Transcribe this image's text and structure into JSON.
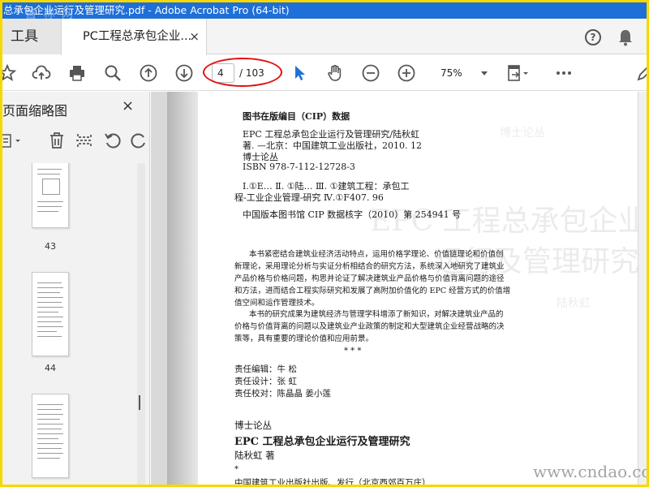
{
  "window": {
    "title": "总承包企业运行及管理研究.pdf - Adobe Acrobat Pro (64-bit)",
    "watermark": "首 称 网"
  },
  "tabs": {
    "tools": "工具",
    "doc": "PC工程总承包企业...",
    "close": "×"
  },
  "toolbar": {
    "page_current": "4",
    "page_total": "/ 103",
    "zoom": "75%"
  },
  "panel": {
    "title": "页面缩略图",
    "close": "×",
    "thumbs": [
      "43",
      "44"
    ]
  },
  "doc": {
    "cip_title": "图书在版编目（CIP）数据",
    "cip_lines": [
      "EPC 工程总承包企业运行及管理研究/陆秋虹",
      "著. —北京：中国建筑工业出版社，2010. 12",
      "博士论丛",
      "ISBN 978-7-112-12728-3",
      "Ⅰ.①E…  Ⅱ. ①陆…  Ⅲ. ①建筑工程：承包工",
      "程-工业企业管理-研究  Ⅳ.①F407. 96"
    ],
    "cip_number": "中国版本图书馆 CIP 数据核字（2010）第 254941 号",
    "abstract": [
      "本书紧密结合建筑业经济活动特点，运用价格学理论、价值链理论和价值创",
      "新理论，采用理论分析与实证分析相结合的研究方法，系统深入地研究了建筑业",
      "产品价格与价格问题，构思并论证了解决建筑业产品价格与价值背离问题的途径",
      "和方法，进而结合工程实际研究和发展了高附加价值化的 EPC 经营方式的价值增",
      "值空间和运作管理技术。",
      "本书的研究成果为建筑经济与管理学科增添了新知识，对解决建筑业产品的",
      "价格与价值背离的问题以及建筑业产业政策的制定和大型建筑企业经营战略的决",
      "策等，具有重要的理论价值和应用前景。"
    ],
    "stars": "*      *      *",
    "credits": [
      "责任编辑：牛   松",
      "责任设计：张   虹",
      "责任校对：陈晶晶   姜小莲"
    ],
    "series": "博士论丛",
    "book_title": "EPC 工程总承包企业运行及管理研究",
    "author": "陆秋虹   著",
    "star2": "*",
    "publisher": "中国建筑工业出版社出版、发行（北京西郊百万庄）",
    "ghost_big1": "EPC 工程总承包企业",
    "ghost_big2": "运行及管理研究",
    "ghost_small": "博士论丛",
    "ghost_mid": "陆秋虹"
  },
  "site_watermark": "www.cndao.com"
}
